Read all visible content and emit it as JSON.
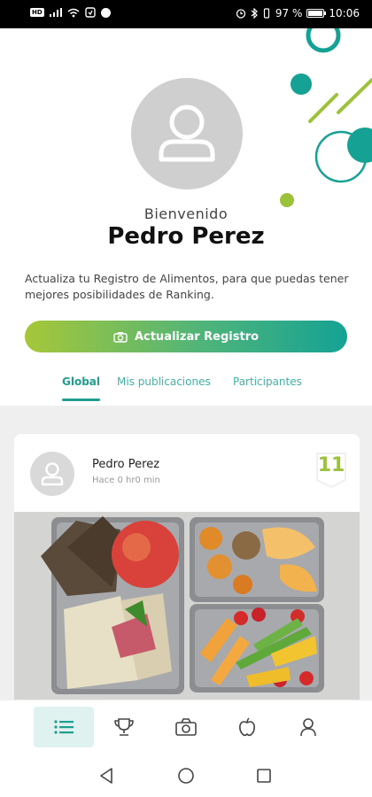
{
  "status_bar": {
    "sim_label": "HD",
    "battery_text": "97 %",
    "battery_level": 0.97,
    "time": "10:06"
  },
  "profile": {
    "welcome": "Bienvenido",
    "name": "Pedro Perez",
    "info": "Actualiza tu Registro de Alimentos, para que puedas tener mejores posibilidades de Ranking.",
    "update_button": "Actualizar Registro"
  },
  "tabs": [
    {
      "label": "Global",
      "active": true
    },
    {
      "label": "Mis publicaciones",
      "active": false
    },
    {
      "label": "Participantes",
      "active": false
    }
  ],
  "post": {
    "author": "Pedro Perez",
    "time": "Hace 0 hr0 min",
    "score": "11"
  },
  "bottom_nav": [
    {
      "icon": "list-icon",
      "active": true
    },
    {
      "icon": "trophy-icon",
      "active": false
    },
    {
      "icon": "camera-icon",
      "active": false
    },
    {
      "icon": "apple-icon",
      "active": false
    },
    {
      "icon": "user-icon",
      "active": false
    }
  ],
  "colors": {
    "accent": "#1f9e8e",
    "lime": "#9cc23a",
    "gradient_start": "#a6c738",
    "gradient_end": "#15a294"
  }
}
